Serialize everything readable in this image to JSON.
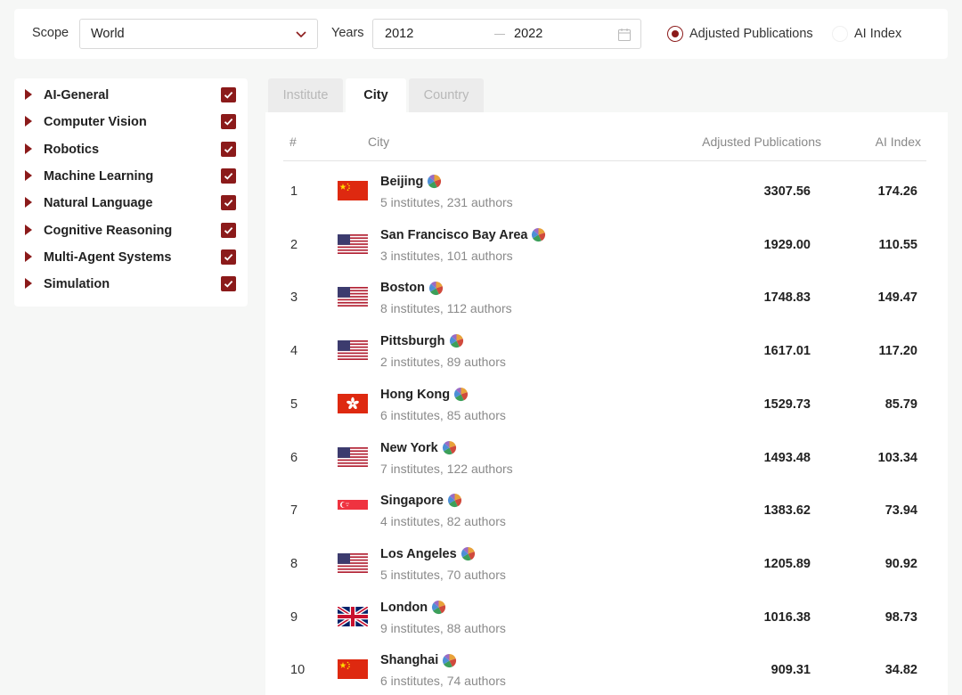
{
  "filters": {
    "scope_label": "Scope",
    "scope_value": "World",
    "years_label": "Years",
    "year_from": "2012",
    "year_to": "2022",
    "radio_adjusted": "Adjusted Publications",
    "radio_ai_index": "AI Index",
    "selected_metric": "Adjusted Publications"
  },
  "categories": [
    {
      "label": "AI-General",
      "checked": true
    },
    {
      "label": "Computer Vision",
      "checked": true
    },
    {
      "label": "Robotics",
      "checked": true
    },
    {
      "label": "Machine Learning",
      "checked": true
    },
    {
      "label": "Natural Language",
      "checked": true
    },
    {
      "label": "Cognitive Reasoning",
      "checked": true
    },
    {
      "label": "Multi-Agent Systems",
      "checked": true
    },
    {
      "label": "Simulation",
      "checked": true
    }
  ],
  "tabs": [
    {
      "label": "Institute",
      "active": false
    },
    {
      "label": "City",
      "active": true
    },
    {
      "label": "Country",
      "active": false
    }
  ],
  "table": {
    "headers": {
      "rank": "#",
      "city": "City",
      "pubs": "Adjusted Publications",
      "index": "AI Index"
    },
    "rows": [
      {
        "rank": "1",
        "flag": "cn-flag",
        "city": "Beijing",
        "sub": "5 institutes, 231 authors",
        "pubs": "3307.56",
        "index": "174.26"
      },
      {
        "rank": "2",
        "flag": "us-flag",
        "city": "San Francisco Bay Area",
        "sub": "3 institutes, 101 authors",
        "pubs": "1929.00",
        "index": "110.55"
      },
      {
        "rank": "3",
        "flag": "us-flag",
        "city": "Boston",
        "sub": "8 institutes, 112 authors",
        "pubs": "1748.83",
        "index": "149.47"
      },
      {
        "rank": "4",
        "flag": "us-flag",
        "city": "Pittsburgh",
        "sub": "2 institutes, 89 authors",
        "pubs": "1617.01",
        "index": "117.20"
      },
      {
        "rank": "5",
        "flag": "hk-flag",
        "city": "Hong Kong",
        "sub": "6 institutes, 85 authors",
        "pubs": "1529.73",
        "index": "85.79"
      },
      {
        "rank": "6",
        "flag": "us-flag",
        "city": "New York",
        "sub": "7 institutes, 122 authors",
        "pubs": "1493.48",
        "index": "103.34"
      },
      {
        "rank": "7",
        "flag": "sg-flag",
        "city": "Singapore",
        "sub": "4 institutes, 82 authors",
        "pubs": "1383.62",
        "index": "73.94"
      },
      {
        "rank": "8",
        "flag": "us-flag",
        "city": "Los Angeles",
        "sub": "5 institutes, 70 authors",
        "pubs": "1205.89",
        "index": "90.92"
      },
      {
        "rank": "9",
        "flag": "uk-flag",
        "city": "London",
        "sub": "9 institutes, 88 authors",
        "pubs": "1016.38",
        "index": "98.73"
      },
      {
        "rank": "10",
        "flag": "cn-flag",
        "city": "Shanghai",
        "sub": "6 institutes, 74 authors",
        "pubs": "909.31",
        "index": "34.82"
      }
    ]
  },
  "colors": {
    "accent": "#8b1a1a"
  }
}
